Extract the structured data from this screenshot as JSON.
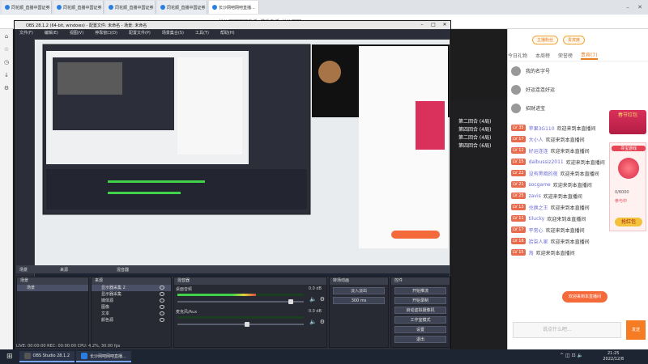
{
  "browser": {
    "tabs": [
      {
        "label": "同花顺_直播中国证券"
      },
      {
        "label": "同花顺_直播中国证券"
      },
      {
        "label": "同花顺_直播中国证券"
      },
      {
        "label": "同花顺_直播中国证券"
      },
      {
        "label": "长沙网吧网吧直播..."
      }
    ],
    "address": "长沙网吧网吧直播_游戏直播_长沙网吧"
  },
  "obs": {
    "title": "OBS 28.1.2 (64-bit, windows) - 配置文件: 未命名 - 场景: 未命名",
    "menu": [
      "文件(F)",
      "编辑(E)",
      "视图(V)",
      "停靠窗口(D)",
      "配置文件(P)",
      "场景集合(S)",
      "工具(T)",
      "帮助(H)"
    ],
    "dock_bar": [
      "场景",
      "来源",
      "混音器"
    ],
    "scenes": {
      "title": "场景",
      "items": [
        "场景"
      ]
    },
    "sources": {
      "title": "来源",
      "items": [
        "显示器采集 2",
        "显示器采集",
        "媒体源",
        "图像",
        "文本",
        "颜色源"
      ]
    },
    "mixer": {
      "title": "混音器",
      "channels": [
        {
          "name": "桌面音频",
          "db": "0.0 dB",
          "level": 0.62,
          "vol": 0.9
        },
        {
          "name": "麦克风/Aux",
          "db": "0.0 dB",
          "level": 0.0,
          "vol": 0.55
        }
      ]
    },
    "transitions": {
      "title": "转场动画",
      "value": "淡入淡出",
      "duration": "300 ms"
    },
    "controls": {
      "title": "控件",
      "buttons": [
        "开始推流",
        "开始录制",
        "启动虚拟摄像机",
        "工作室模式",
        "设置",
        "退出"
      ]
    },
    "status": "LIVE: 00:00:00   REC: 00:00:00   CPU: 4.2%, 30.00 fps"
  },
  "room": {
    "lines": [
      "第二回合 (4局)",
      "第四回合 (4局)",
      "第二回合 (4局)",
      "第四回合 (6局)"
    ]
  },
  "chat": {
    "top_pills": [
      "主播粉丝",
      "贵宾席"
    ],
    "tabs": [
      "今日礼物",
      "本周榜",
      "荣誉榜",
      "贵宾(7)"
    ],
    "active_tab": 3,
    "top_users": [
      "我的名字号",
      "好运连连好运",
      "招财进宝"
    ],
    "messages": [
      {
        "lv": "LV 35",
        "name": "苹果3G110",
        "text": "欢迎来到本直播间"
      },
      {
        "lv": "LV 17",
        "name": "大小人",
        "text": "欢迎来到本直播间"
      },
      {
        "lv": "LV 12",
        "name": "好运连连",
        "text": "欢迎来到本直播间"
      },
      {
        "lv": "LV 15",
        "name": "dalbussiz2011",
        "text": "欢迎来到本直播间"
      },
      {
        "lv": "LV 22",
        "name": "没有黑暗的夜",
        "text": "欢迎来到本直播间"
      },
      {
        "lv": "LV 21",
        "name": "socgame",
        "text": "欢迎来到本直播间"
      },
      {
        "lv": "LV 25",
        "name": "zavis",
        "text": "欢迎来到本直播间"
      },
      {
        "lv": "LV 13",
        "name": "兑换之王",
        "text": "欢迎来到本直播间"
      },
      {
        "lv": "LV 11",
        "name": "tilucky",
        "text": "欢迎来到本直播间"
      },
      {
        "lv": "LV 17",
        "name": "平常心",
        "text": "欢迎来到本直播间"
      },
      {
        "lv": "LV 18",
        "name": "拾柒人家",
        "text": "欢迎来到本直播间"
      },
      {
        "lv": "LV 15",
        "name": "淘",
        "text": "欢迎来到本直播间"
      }
    ],
    "gift_label": "春节红包",
    "redbag": {
      "title": "寻宝游戏",
      "time": "0/6000",
      "count": "参与中",
      "button": "抢红包"
    },
    "speak_bubble": "欢迎来到本直播间",
    "input_placeholder": "说点什么吧...",
    "send_label": "发送"
  },
  "taskbar": {
    "items": [
      "OBS Studio 28.1.2",
      "长沙网吧网吧直播..."
    ],
    "time": "21:25",
    "date": "2022/12/8"
  }
}
